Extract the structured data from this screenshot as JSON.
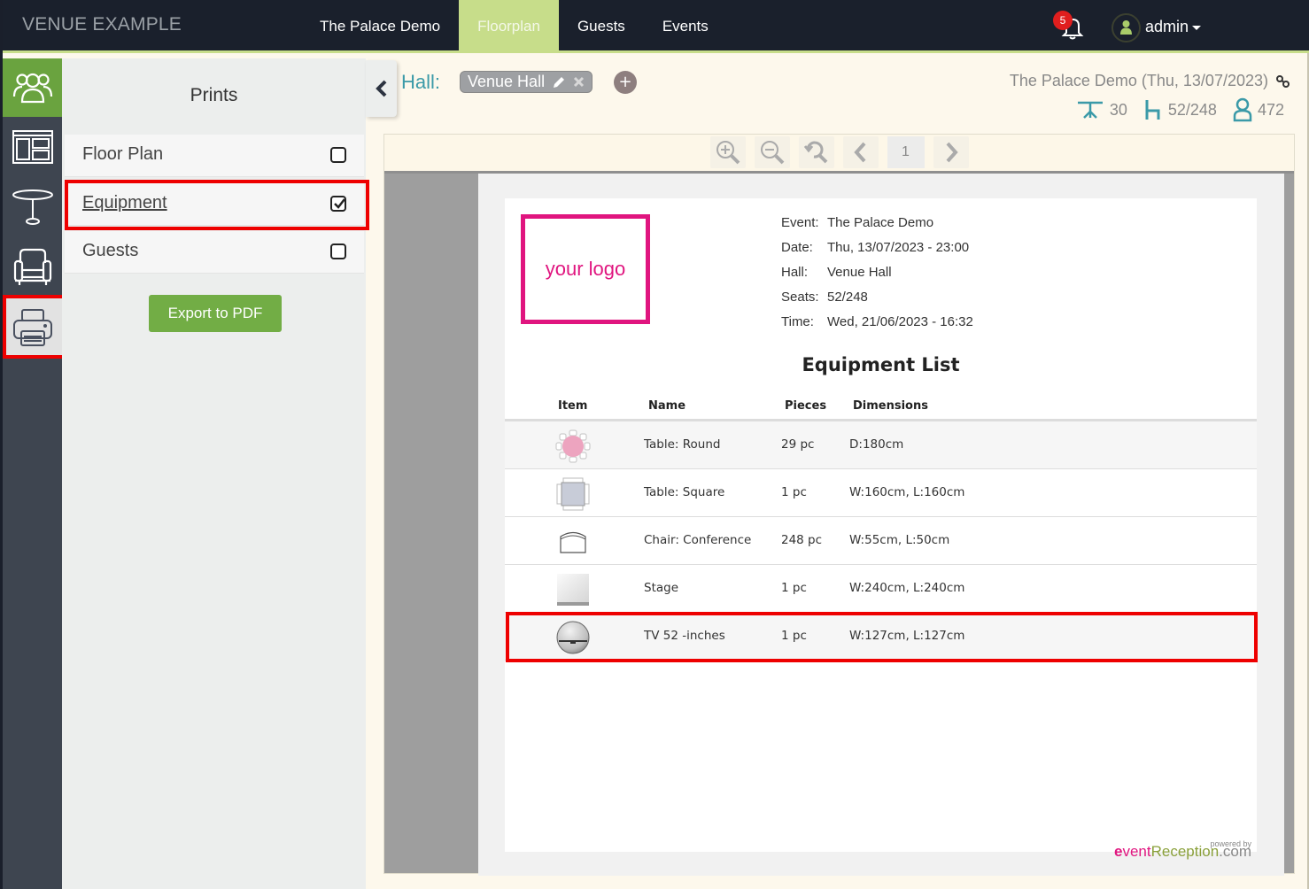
{
  "topbar": {
    "brand": "VENUE EXAMPLE",
    "nav": [
      {
        "label": "The Palace Demo",
        "active": false
      },
      {
        "label": "Floorplan",
        "active": true
      },
      {
        "label": "Guests",
        "active": false
      },
      {
        "label": "Events",
        "active": false
      }
    ],
    "notifications_count": "5",
    "user": "admin"
  },
  "rail": {
    "items": [
      {
        "icon": "users-icon",
        "active": true
      },
      {
        "icon": "layout-icon",
        "active": false
      },
      {
        "icon": "table-icon",
        "active": false
      },
      {
        "icon": "armchair-icon",
        "active": false
      },
      {
        "icon": "printer-icon",
        "selected": true
      }
    ]
  },
  "panel": {
    "title": "Prints",
    "options": [
      {
        "label": "Floor Plan",
        "checked": false
      },
      {
        "label": "Equipment",
        "checked": true
      },
      {
        "label": "Guests",
        "checked": false
      }
    ],
    "export_label": "Export to PDF"
  },
  "hall": {
    "label": "Hall:",
    "name": "Venue Hall",
    "add_label": "+"
  },
  "event": {
    "title": "The Palace Demo (Thu, 13/07/2023)",
    "tables": "30",
    "seats": "52/248",
    "guests": "472"
  },
  "viewer": {
    "page": "1"
  },
  "document": {
    "logo_text": "your logo",
    "meta": [
      {
        "key": "Event:",
        "value": "The Palace Demo"
      },
      {
        "key": "Date:",
        "value": "Thu, 13/07/2023 - 23:00"
      },
      {
        "key": "Hall:",
        "value": "Venue Hall"
      },
      {
        "key": "Seats:",
        "value": "52/248"
      },
      {
        "key": "Time:",
        "value": "Wed, 21/06/2023 - 16:32"
      }
    ],
    "title": "Equipment List",
    "columns": {
      "item": "Item",
      "name": "Name",
      "pieces": "Pieces",
      "dimensions": "Dimensions"
    },
    "rows": [
      {
        "icon": "round-table-icon",
        "name": "Table: Round",
        "pieces": "29 pc",
        "dimensions": "D:180cm"
      },
      {
        "icon": "square-table-icon",
        "name": "Table: Square",
        "pieces": "1 pc",
        "dimensions": "W:160cm, L:160cm"
      },
      {
        "icon": "conference-chair-icon",
        "name": "Chair: Conference",
        "pieces": "248 pc",
        "dimensions": "W:55cm, L:50cm"
      },
      {
        "icon": "stage-icon",
        "name": "Stage",
        "pieces": "1 pc",
        "dimensions": "W:240cm, L:240cm"
      },
      {
        "icon": "tv-icon",
        "name": "TV 52 -inches",
        "pieces": "1 pc",
        "dimensions": "W:127cm, L:127cm"
      }
    ],
    "powered_by": "powered by",
    "powered_brand": {
      "e": "e",
      "vent": "vent",
      "reception": "Reception",
      "dotcom": ".com"
    }
  },
  "colors": {
    "topbar_bg": "#1a202c",
    "accent_green": "#c7dd8a",
    "button_green": "#72ad45",
    "rail_green": "#6aa33f",
    "teal": "#3b9aa8",
    "logo_pink": "#e0157f",
    "annotation_red": "#ee0000"
  }
}
